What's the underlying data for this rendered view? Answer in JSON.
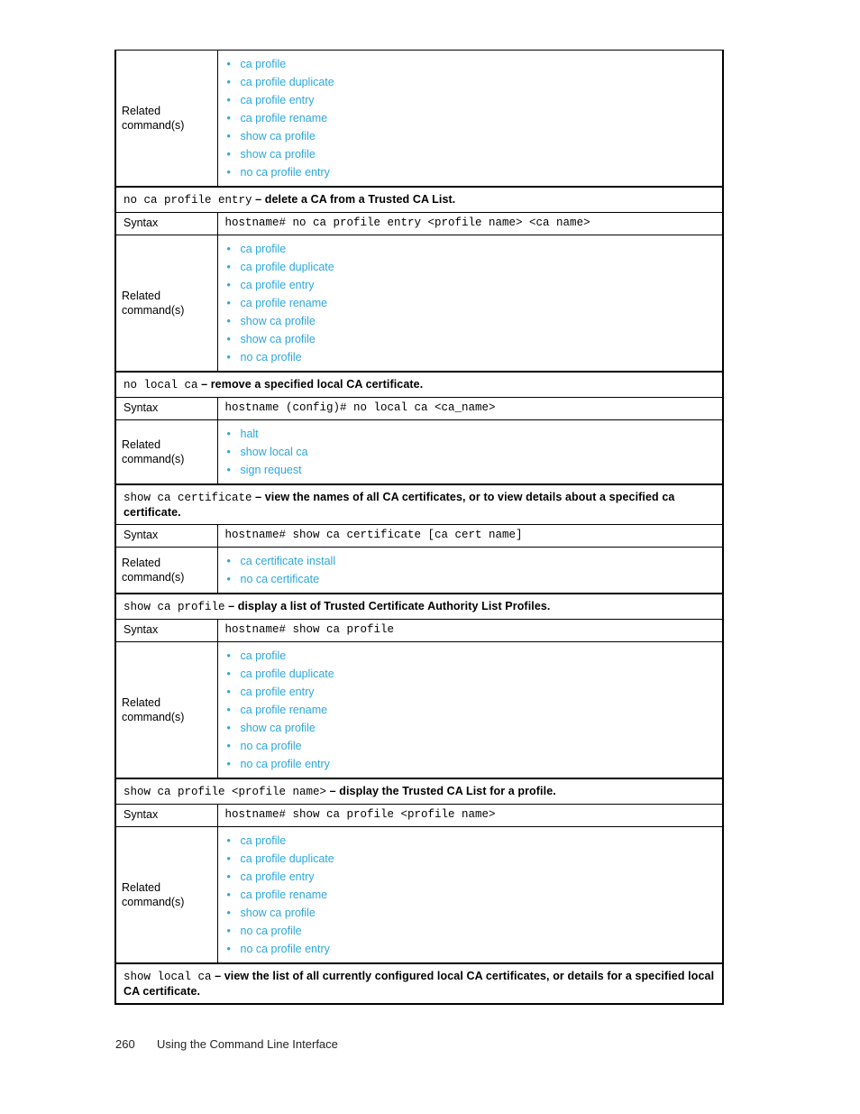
{
  "page": {
    "number": "260",
    "footer_title": "Using the Command Line Interface"
  },
  "labels": {
    "related": "Related\ncommand(s)",
    "related_line1": "Related",
    "related_line2": "command(s)",
    "syntax": "Syntax",
    "bullet": "•",
    "dash": " – "
  },
  "colors": {
    "link": "#2da7dc",
    "text": "#000000",
    "border": "#000000"
  },
  "sections": [
    {
      "id": "ca-profile-entry-continued",
      "related_label": "Related command(s)",
      "related_links": [
        "ca profile",
        "ca profile duplicate",
        "ca profile entry",
        "ca profile rename",
        "show ca profile",
        "show ca profile",
        "no ca profile entry"
      ]
    },
    {
      "id": "no-ca-profile-entry",
      "heading_code": "no ca profile entry",
      "heading_desc": "delete a CA from a Trusted CA List.",
      "syntax_label": "Syntax",
      "syntax_code": "hostname# no ca profile entry <profile name> <ca name>",
      "related_label": "Related command(s)",
      "related_links": [
        "ca profile",
        "ca profile duplicate",
        "ca profile entry",
        "ca profile rename",
        "show ca profile",
        "show ca profile",
        "no ca profile"
      ]
    },
    {
      "id": "no-local-ca",
      "heading_code": "no local ca",
      "heading_desc": "remove a specified local CA certificate.",
      "syntax_label": "Syntax",
      "syntax_code": "hostname (config)# no local ca <ca_name>",
      "related_label": "Related command(s)",
      "related_links": [
        "halt",
        "show local ca",
        "sign request"
      ]
    },
    {
      "id": "show-ca-certificate",
      "heading_code": "show ca certificate",
      "heading_desc": "view the names of all CA certificates, or to view details about a specified ca certificate.",
      "syntax_label": "Syntax",
      "syntax_code": "hostname# show ca certificate [ca cert name]",
      "related_label": "Related command(s)",
      "related_links": [
        "ca certificate install",
        "no ca certificate"
      ]
    },
    {
      "id": "show-ca-profile",
      "heading_code": "show ca profile",
      "heading_desc": "display a list of Trusted Certificate Authority List Profiles.",
      "syntax_label": "Syntax",
      "syntax_code": "hostname# show ca profile",
      "related_label": "Related command(s)",
      "related_links": [
        "ca profile",
        "ca profile duplicate",
        "ca profile entry",
        "ca profile rename",
        "show ca profile",
        "no ca profile",
        "no ca profile entry"
      ]
    },
    {
      "id": "show-ca-profile-name",
      "heading_code": "show ca profile <profile name>",
      "heading_desc": "display the Trusted CA List for a profile.",
      "syntax_label": "Syntax",
      "syntax_code": "hostname# show ca profile <profile name>",
      "related_label": "Related command(s)",
      "related_links": [
        "ca profile",
        "ca profile duplicate",
        "ca profile entry",
        "ca profile rename",
        "show ca profile",
        "no ca profile",
        "no ca profile entry"
      ]
    },
    {
      "id": "show-local-ca",
      "heading_code": "show local ca",
      "heading_desc": "view the list of all currently configured local CA certificates, or details for a specified local CA certificate."
    }
  ]
}
